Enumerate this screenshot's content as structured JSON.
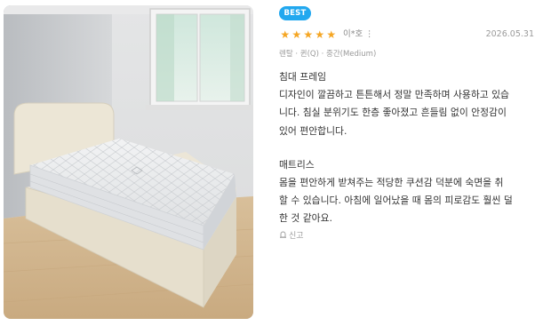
{
  "badge": "BEST",
  "rating": {
    "value": 5,
    "max": 5,
    "star_color": "#f5a623"
  },
  "author": "이*호",
  "more_icon": "kebab-icon",
  "date": "2026.05.31",
  "options": "렌탈 · 퀸(Q) · 중간(Medium)",
  "sections": [
    {
      "title": "침대 프레임",
      "lines": [
        "디자인이 깔끔하고 튼튼해서 정말 만족하며 사용하고 있습",
        "니다. 침실 분위기도 한층 좋아졌고 흔들림 없이 안정감이",
        "있어 편안합니다."
      ]
    },
    {
      "title": "매트리스",
      "lines": [
        "몸을 편안하게 받쳐주는 적당한 쿠션감 덕분에 숙면을 취",
        "할 수 있습니다. 아침에 일어났을 때 몸의 피로감도 훨씬 덜",
        "한 것 같아요."
      ]
    }
  ],
  "report_label": "신고",
  "colors": {
    "badge": "#22a8ef",
    "muted": "#9a9a9a",
    "text": "#333333"
  }
}
